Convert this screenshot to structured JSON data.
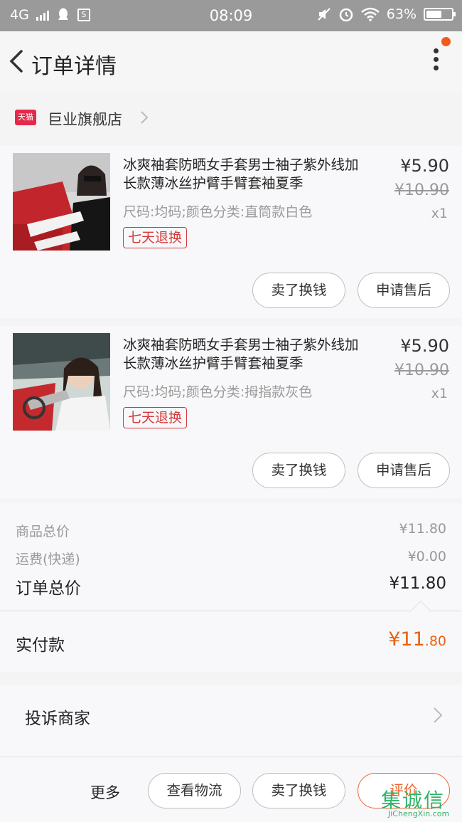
{
  "status_bar": {
    "network": "4G",
    "time": "08:09",
    "battery_percent": "63%",
    "battery_level": 0.63,
    "icons": [
      "signal-icon",
      "qq-icon",
      "s-app-icon",
      "mute-icon",
      "alarm-icon",
      "wifi-icon",
      "battery-icon"
    ]
  },
  "header": {
    "title": "订单详情",
    "menu_icon": "more-vertical-icon",
    "notification_dot_color": "#f05a1a"
  },
  "shop": {
    "logo_text": "天猫",
    "name": "巨业旗舰店"
  },
  "items": [
    {
      "title": "冰爽袖套防晒女手套男士袖子紫外线加长款薄冰丝护臂手臂套袖夏季",
      "sku": "尺码:均码;颜色分类:直筒款白色",
      "badge": "七天退换",
      "price": "¥5.90",
      "original_price": "¥10.90",
      "quantity": "x1",
      "buttons": [
        "卖了换钱",
        "申请售后"
      ]
    },
    {
      "title": "冰爽袖套防晒女手套男士袖子紫外线加长款薄冰丝护臂手臂套袖夏季",
      "sku": "尺码:均码;颜色分类:拇指款灰色",
      "badge": "七天退换",
      "price": "¥5.90",
      "original_price": "¥10.90",
      "quantity": "x1",
      "buttons": [
        "卖了换钱",
        "申请售后"
      ]
    }
  ],
  "summary": {
    "goods_total_label": "商品总价",
    "goods_total": "¥11.80",
    "shipping_label": "运费(快递)",
    "shipping": "¥0.00",
    "order_total_label": "订单总价",
    "order_total": "¥11.80",
    "paid_label": "实付款",
    "paid_symbol": "¥",
    "paid_int": "11",
    "paid_cents": ".80"
  },
  "complain": {
    "label": "投诉商家"
  },
  "bottom_bar": {
    "more_label": "更多",
    "logistics_label": "查看物流",
    "sell_label": "卖了换钱",
    "review_label": "评价"
  },
  "watermark": {
    "cn": "集诚信",
    "en": "JiChengXin.com"
  },
  "colors": {
    "accent_orange": "#e8620f",
    "badge_red": "#d43a3a",
    "tmall_red": "#e5294b"
  }
}
